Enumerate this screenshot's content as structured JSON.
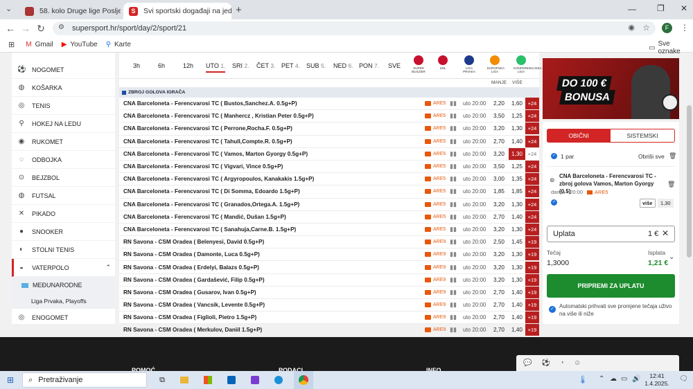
{
  "browser": {
    "tabs": [
      {
        "title": "58. kolo Druge lige Posljednje s"
      },
      {
        "title": "Svi sportski događaji na jednom"
      }
    ],
    "url": "supersport.hr/sport/day/2/sport/21",
    "bookmarks": [
      {
        "label": "Gmail"
      },
      {
        "label": "YouTube"
      },
      {
        "label": "Karte"
      }
    ],
    "all_bookmarks": "Sve oznake",
    "profile_initial": "F"
  },
  "sidebar": {
    "items": [
      {
        "label": "NOGOMET",
        "icon": "soccer-ball-icon"
      },
      {
        "label": "KOŠARKA",
        "icon": "basketball-icon"
      },
      {
        "label": "TENIS",
        "icon": "tennis-ball-icon"
      },
      {
        "label": "HOKEJ NA LEDU",
        "icon": "hockey-icon"
      },
      {
        "label": "RUKOMET",
        "icon": "handball-icon"
      },
      {
        "label": "ODBOJKA",
        "icon": "volleyball-icon"
      },
      {
        "label": "BEJZBOL",
        "icon": "baseball-icon"
      },
      {
        "label": "FUTSAL",
        "icon": "futsal-icon"
      },
      {
        "label": "PIKADO",
        "icon": "darts-icon"
      },
      {
        "label": "SNOOKER",
        "icon": "snooker-icon"
      },
      {
        "label": "STOLNI TENIS",
        "icon": "table-tennis-icon"
      },
      {
        "label": "VATERPOLO",
        "icon": "waterpolo-icon"
      }
    ],
    "sub_category": "MEĐUNARODNE",
    "sub_sub": "Liga Prvaka, Playoffs",
    "after": {
      "label": "ENOGOMET",
      "icon": "esoccer-icon"
    }
  },
  "timebar": {
    "filters": [
      {
        "label": "3h",
        "num": ""
      },
      {
        "label": "6h",
        "num": ""
      },
      {
        "label": "12h",
        "num": ""
      },
      {
        "label": "UTO",
        "num": "1."
      },
      {
        "label": "SRI",
        "num": "2."
      },
      {
        "label": "ČET",
        "num": "3."
      },
      {
        "label": "PET",
        "num": "4."
      },
      {
        "label": "SUB",
        "num": "5."
      },
      {
        "label": "NED",
        "num": "6."
      },
      {
        "label": "PON",
        "num": "7."
      },
      {
        "label": "SVE",
        "num": ""
      }
    ],
    "logos": [
      {
        "label": "SUPER BUILDER",
        "color": "#c8102e"
      },
      {
        "label": "SNL",
        "color": "#c8102e"
      },
      {
        "label": "LIGA PRVAKA",
        "color": "#1e3a8a"
      },
      {
        "label": "EUROPSKA LIGA",
        "color": "#f28c00"
      },
      {
        "label": "KONFERENCIJSKA LIGA",
        "color": "#2bbf6a"
      }
    ]
  },
  "table": {
    "col_manje": "MANJE",
    "col_vise": "VIŠE",
    "section_title": "ZBROJ GOLOVA IGRAČA",
    "rows": [
      {
        "name": "CNA Barceloneta - Ferencvarosi TC ( Bustos,Sanchez.A. 0.5g+P)",
        "ares": "ARE5",
        "time": "uto 20:00",
        "o1": "2,20",
        "o2": "1,60",
        "plus": "+24",
        "hl": false
      },
      {
        "name": "CNA Barceloneta - Ferencvarosi TC ( Manhercz , Kristian Peter 0.5g+P)",
        "ares": "ARE5",
        "time": "uto 20:00",
        "o1": "3,50",
        "o2": "1,25",
        "plus": "+24",
        "hl": false
      },
      {
        "name": "CNA Barceloneta - Ferencvarosi TC ( Perrone,Rocha.F. 0.5g+P)",
        "ares": "ARE5",
        "time": "uto 20:00",
        "o1": "3,20",
        "o2": "1,30",
        "plus": "+24",
        "hl": false
      },
      {
        "name": "CNA Barceloneta - Ferencvarosi TC ( Tahull,Compte.R. 0.5g+P)",
        "ares": "ARE5",
        "time": "uto 20:00",
        "o1": "2,70",
        "o2": "1,40",
        "plus": "+24",
        "hl": false
      },
      {
        "name": "CNA Barceloneta - Ferencvarosi TC ( Vamos, Marton Gyorgy 0.5g+P)",
        "ares": "ARE5",
        "time": "uto 20:00",
        "o1": "3,20",
        "o2": "1,30",
        "plus": "+24",
        "hl": true
      },
      {
        "name": "CNA Barceloneta - Ferencvarosi TC ( Vigvari, Vince 0.5g+P)",
        "ares": "ARE5",
        "time": "uto 20:00",
        "o1": "3,50",
        "o2": "1,25",
        "plus": "+24",
        "hl": false
      },
      {
        "name": "CNA Barceloneta - Ferencvarosi TC ( Argyropoulos, Kanakakis 1.5g+P)",
        "ares": "ARE5",
        "time": "uto 20:00",
        "o1": "3,00",
        "o2": "1,35",
        "plus": "+24",
        "hl": false
      },
      {
        "name": "CNA Barceloneta - Ferencvarosi TC ( Di Somma, Edoardo 1.5g+P)",
        "ares": "ARE5",
        "time": "uto 20:00",
        "o1": "1,85",
        "o2": "1,85",
        "plus": "+24",
        "hl": false
      },
      {
        "name": "CNA Barceloneta - Ferencvarosi TC ( Granados,Ortega.A. 1.5g+P)",
        "ares": "ARE5",
        "time": "uto 20:00",
        "o1": "3,20",
        "o2": "1,30",
        "plus": "+24",
        "hl": false
      },
      {
        "name": "CNA Barceloneta - Ferencvarosi TC ( Mandić, Dušan 1.5g+P)",
        "ares": "ARE5",
        "time": "uto 20:00",
        "o1": "2,70",
        "o2": "1,40",
        "plus": "+24",
        "hl": false
      },
      {
        "name": "CNA Barceloneta - Ferencvarosi TC ( Sanahuja,Carne.B. 1.5g+P)",
        "ares": "ARE5",
        "time": "uto 20:00",
        "o1": "3,20",
        "o2": "1,30",
        "plus": "+24",
        "hl": false
      },
      {
        "name": "RN Savona - CSM Oradea ( Belenyesi, David 0.5g+P)",
        "ares": "ARE9",
        "time": "uto 20:00",
        "o1": "2,50",
        "o2": "1,45",
        "plus": "+19",
        "hl": false
      },
      {
        "name": "RN Savona - CSM Oradea ( Damonte, Luca 0.5g+P)",
        "ares": "ARE9",
        "time": "uto 20:00",
        "o1": "3,20",
        "o2": "1,30",
        "plus": "+19",
        "hl": false
      },
      {
        "name": "RN Savona - CSM Oradea ( Erdelyi, Balazs 0.5g+P)",
        "ares": "ARE9",
        "time": "uto 20:00",
        "o1": "3,20",
        "o2": "1,30",
        "plus": "+19",
        "hl": false
      },
      {
        "name": "RN Savona - CSM Oradea ( Gardašević, Filip 0.5g+P)",
        "ares": "ARE9",
        "time": "uto 20:00",
        "o1": "3,20",
        "o2": "1,30",
        "plus": "+19",
        "hl": false
      },
      {
        "name": "RN Savona - CSM Oradea ( Gusarov, Ivan 0.5g+P)",
        "ares": "ARE9",
        "time": "uto 20:00",
        "o1": "2,70",
        "o2": "1,40",
        "plus": "+19",
        "hl": false
      },
      {
        "name": "RN Savona - CSM Oradea ( Vancsik, Levente 0.5g+P)",
        "ares": "ARE9",
        "time": "uto 20:00",
        "o1": "2,70",
        "o2": "1,40",
        "plus": "+19",
        "hl": false
      },
      {
        "name": "RN Savona - CSM Oradea ( Figlioli, Pietro 1.5g+P)",
        "ares": "ARE9",
        "time": "uto 20:00",
        "o1": "2,70",
        "o2": "1,40",
        "plus": "+19",
        "hl": false
      },
      {
        "name": "RN Savona - CSM Oradea ( Merkulov, Daniil 1.5g+P)",
        "ares": "ARE9",
        "time": "uto 20:00",
        "o1": "2,70",
        "o2": "1,40",
        "plus": "+19",
        "hl": false
      }
    ]
  },
  "promo": {
    "line1": "DO 100 €",
    "line2": "BONUSA"
  },
  "slip": {
    "tab_single": "OBIČNI",
    "tab_system": "SISTEMSKI",
    "pair_count": "1 par",
    "clear_all": "Obriši sve",
    "bet_title": "CNA Barceloneta - Ferencvarosi TC - zbroj golova Vamos, Marton Gyorgy (0.5)",
    "bet_time": "danas • 20:00",
    "bet_ares": "ARE5",
    "bet_pick": "više",
    "bet_odd": "1,30",
    "stake_label": "Uplata",
    "stake_value": "1 €",
    "odds_label": "Tečaj",
    "odds_value": "1,3000",
    "payout_label": "Isplata",
    "payout_value": "1,21 €",
    "submit": "PRIPREMI ZA UPLATU",
    "auto_accept": "Automatski prihvati sve promjene tečaja uživo na više ili niže"
  },
  "footer": {
    "c1": "POMOĆ",
    "c2": "PODACI",
    "c3": "INFO"
  },
  "taskbar": {
    "search": "Pretraživanje",
    "time": "12:41",
    "date": "1.4.2025."
  },
  "colors": {
    "brand_red": "#d32525",
    "dark_red": "#b81f1f",
    "green": "#1c8c2e",
    "orange": "#e8580c"
  }
}
